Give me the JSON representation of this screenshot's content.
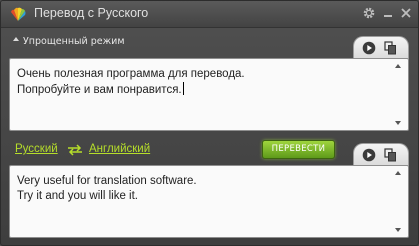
{
  "window": {
    "title": "Перевод с Русского"
  },
  "source_panel": {
    "mode_label": "Упрощенный режим",
    "lines": [
      "Очень полезная программа для перевода.",
      "Попробуйте и вам понравится."
    ]
  },
  "language_bar": {
    "from_language": "Русский",
    "to_language": "Английский",
    "translate_label": "ПЕРЕВЕСТИ"
  },
  "result_panel": {
    "lines": [
      "Very useful for translation software.",
      "Try it and you will like it."
    ]
  },
  "colors": {
    "accent_green": "#b6de2a",
    "button_green": "#7ab52a",
    "window_bg": "#474747"
  },
  "icons": [
    "fan-logo-icon",
    "gear-icon",
    "minimize-icon",
    "close-icon",
    "play-icon",
    "copy-icon",
    "swap-arrows-icon",
    "collapse-arrow-icon",
    "scroll-up-icon",
    "scroll-down-icon"
  ]
}
